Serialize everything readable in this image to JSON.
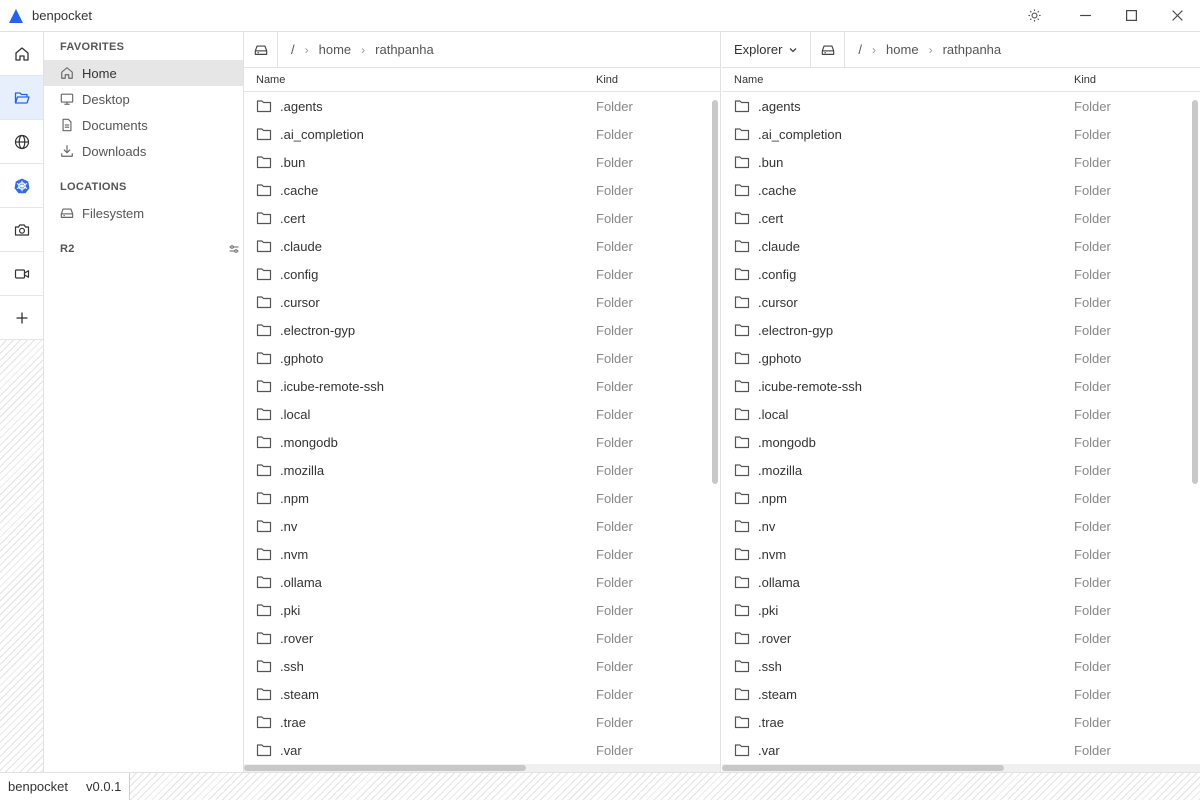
{
  "window": {
    "title": "benpocket",
    "accent": "#2563eb"
  },
  "sidebar": {
    "favorites_heading": "FAVORITES",
    "favorites": [
      {
        "label": "Home",
        "icon": "home-icon"
      },
      {
        "label": "Desktop",
        "icon": "monitor-icon"
      },
      {
        "label": "Documents",
        "icon": "document-icon"
      },
      {
        "label": "Downloads",
        "icon": "download-icon"
      }
    ],
    "locations_heading": "LOCATIONS",
    "locations": [
      {
        "label": "Filesystem",
        "icon": "drive-icon"
      }
    ],
    "r2_heading": "R2"
  },
  "activity": [
    {
      "icon": "home-icon"
    },
    {
      "icon": "folder-open-icon"
    },
    {
      "icon": "globe-icon"
    },
    {
      "icon": "kubernetes-icon"
    },
    {
      "icon": "camera-icon"
    },
    {
      "icon": "video-icon"
    },
    {
      "icon": "plus-icon"
    }
  ],
  "left_pane": {
    "breadcrumb": [
      "/",
      "home",
      "rathpanha"
    ],
    "columns": {
      "name": "Name",
      "kind": "Kind"
    }
  },
  "right_pane": {
    "view_selector": "Explorer",
    "breadcrumb": [
      "/",
      "home",
      "rathpanha"
    ],
    "columns": {
      "name": "Name",
      "kind": "Kind"
    }
  },
  "files": [
    {
      "name": ".agents",
      "kind": "Folder"
    },
    {
      "name": ".ai_completion",
      "kind": "Folder"
    },
    {
      "name": ".bun",
      "kind": "Folder"
    },
    {
      "name": ".cache",
      "kind": "Folder"
    },
    {
      "name": ".cert",
      "kind": "Folder"
    },
    {
      "name": ".claude",
      "kind": "Folder"
    },
    {
      "name": ".config",
      "kind": "Folder"
    },
    {
      "name": ".cursor",
      "kind": "Folder"
    },
    {
      "name": ".electron-gyp",
      "kind": "Folder"
    },
    {
      "name": ".gphoto",
      "kind": "Folder"
    },
    {
      "name": ".icube-remote-ssh",
      "kind": "Folder"
    },
    {
      "name": ".local",
      "kind": "Folder"
    },
    {
      "name": ".mongodb",
      "kind": "Folder"
    },
    {
      "name": ".mozilla",
      "kind": "Folder"
    },
    {
      "name": ".npm",
      "kind": "Folder"
    },
    {
      "name": ".nv",
      "kind": "Folder"
    },
    {
      "name": ".nvm",
      "kind": "Folder"
    },
    {
      "name": ".ollama",
      "kind": "Folder"
    },
    {
      "name": ".pki",
      "kind": "Folder"
    },
    {
      "name": ".rover",
      "kind": "Folder"
    },
    {
      "name": ".ssh",
      "kind": "Folder"
    },
    {
      "name": ".steam",
      "kind": "Folder"
    },
    {
      "name": ".trae",
      "kind": "Folder"
    },
    {
      "name": ".var",
      "kind": "Folder"
    }
  ],
  "statusbar": {
    "app": "benpocket",
    "version": "v0.0.1"
  }
}
